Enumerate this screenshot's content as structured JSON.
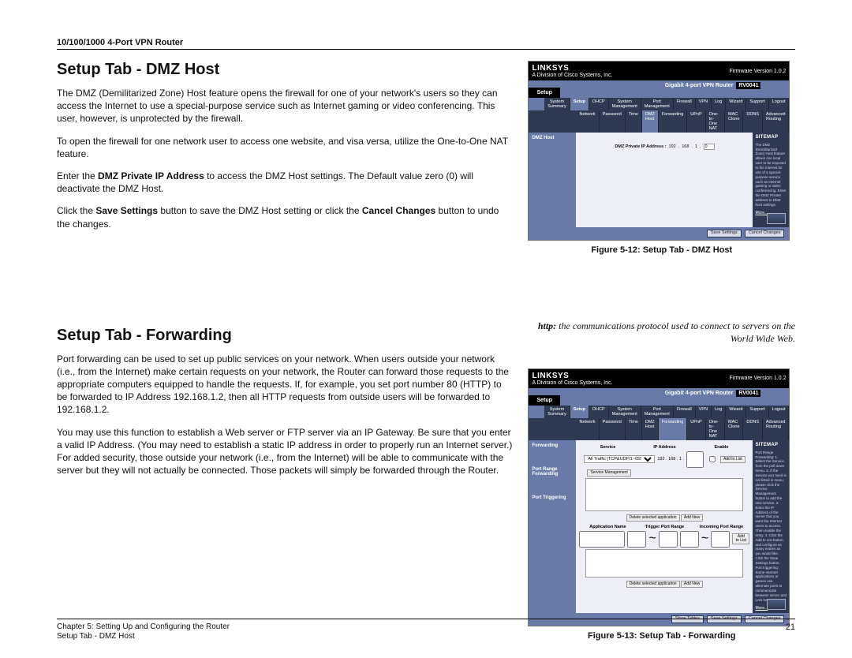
{
  "header": {
    "product": "10/100/1000 4-Port VPN Router"
  },
  "sections": {
    "dmz": {
      "heading": "Setup Tab - DMZ Host",
      "p1": "The DMZ (Demilitarized Zone) Host feature opens the firewall for one of your network's users so they can access the Internet to use a special-purpose service such as Internet gaming or video conferencing. This user, however, is unprotected by the firewall.",
      "p2": "To open the firewall for one network user to access one website, and visa versa, utilize the One-to-One NAT feature.",
      "p3a": "Enter the ",
      "p3_bold": "DMZ Private IP Address",
      "p3b": " to access the DMZ Host settings. The Default value zero (0) will deactivate the DMZ Host.",
      "p4a": "Click the ",
      "p4_bold1": "Save Settings",
      "p4b": " button to save the DMZ Host setting or click the ",
      "p4_bold2": "Cancel Changes",
      "p4c": " button to undo the changes."
    },
    "fwd": {
      "heading": "Setup Tab - Forwarding",
      "p1": "Port forwarding can be used to set up public services on your network. When users outside your network (i.e., from the Internet) make certain requests on your network, the Router can forward those requests to the appropriate computers equipped to handle the requests. If, for example, you set port number 80 (HTTP) to be forwarded to IP Address 192.168.1.2, then all HTTP requests from outside users will be forwarded to 192.168.1.2.",
      "p2": "You may use this function to establish a Web server or FTP server via an IP Gateway. Be sure that you enter a valid IP Address. (You may need to establish a static IP address in order to properly run an Internet server.) For added security, those outside your network (i.e., from the Internet) will be able to communicate with the server but they will not actually be connected. Those packets will simply be forwarded through the Router."
    }
  },
  "callout": {
    "bold": "http:",
    "text": " the communications protocol used to connect to servers on the World Wide Web."
  },
  "figures": {
    "f1": "Figure 5-12: Setup Tab - DMZ Host",
    "f2": "Figure 5-13: Setup Tab - Forwarding"
  },
  "thumb": {
    "brand": "LINKSYS",
    "subbrand": "A Division of Cisco Systems, Inc.",
    "fw": "Firmware Version 1.0.2",
    "product": "Gigabit 4-port VPN Router",
    "model": "RV0041",
    "section": "Setup",
    "mainnav": [
      "System Summary",
      "Setup",
      "DHCP",
      "System Management",
      "Port Management",
      "Firewall",
      "VPN",
      "Log",
      "Wizard",
      "Support",
      "Logout"
    ],
    "subnav_a": [
      "Network",
      "Password",
      "Time",
      "DMZ Host",
      "Forwarding",
      "UPnP",
      "One-to-One NAT",
      "MAC Clone",
      "DDNS",
      "Advanced Routing"
    ],
    "sidelabel_a": "DMZ Host",
    "dmz_label": "DMZ Private IP Address :",
    "dmz_ip": [
      "192",
      "168",
      "1",
      "0"
    ],
    "sitemap": "SITEMAP",
    "help_a": "The DMZ (Demilitarized Zone) Host feature allows one local user to be exposed to the Internet for use of a special-purpose service such as Internet gaming or video conferencing. Enter the DMZ Private address to DMZ host settings.",
    "more": "More...",
    "save": "Save Settings",
    "cancel": "Cancel Changes",
    "sidelabel_b1": "Forwarding",
    "sidelabel_b2": "Port Range Forwarding",
    "sidelabel_b3": "Port Triggering",
    "hdr_service": "Service",
    "hdr_ip": "IP Address",
    "hdr_enable": "Enable",
    "service_sel": "All Traffic [TCP&UDP/1~65535]",
    "ip_prefix": "192 . 168 . 1 .",
    "addtolist": "Add to List",
    "servmgmt": "Service Management",
    "delsel": "Delete selected application",
    "addnew": "Add New",
    "hdr_appname": "Application Name",
    "hdr_trigger": "Trigger Port Range",
    "hdr_incoming": "Incoming Port Range",
    "help_b": "Port Range Forwarding: 1. Select the Service from the pull down menu. 2. If the Service you need is not listed in menu, please click the Service Management button to add the new service. 3. Enter the IP Address of the server that you want the Internet users to access. Then enable the entry. 4. Click the Add to List button, and configure as many entries as you would like. Click the Save Settings button. Port triggering: Some Internet applications or games use alternate ports to communicate between server and LAN host."
  },
  "footer": {
    "chapter": "Chapter 5: Setting Up and Configuring the Router",
    "section": "Setup Tab - DMZ Host",
    "page": "21"
  }
}
